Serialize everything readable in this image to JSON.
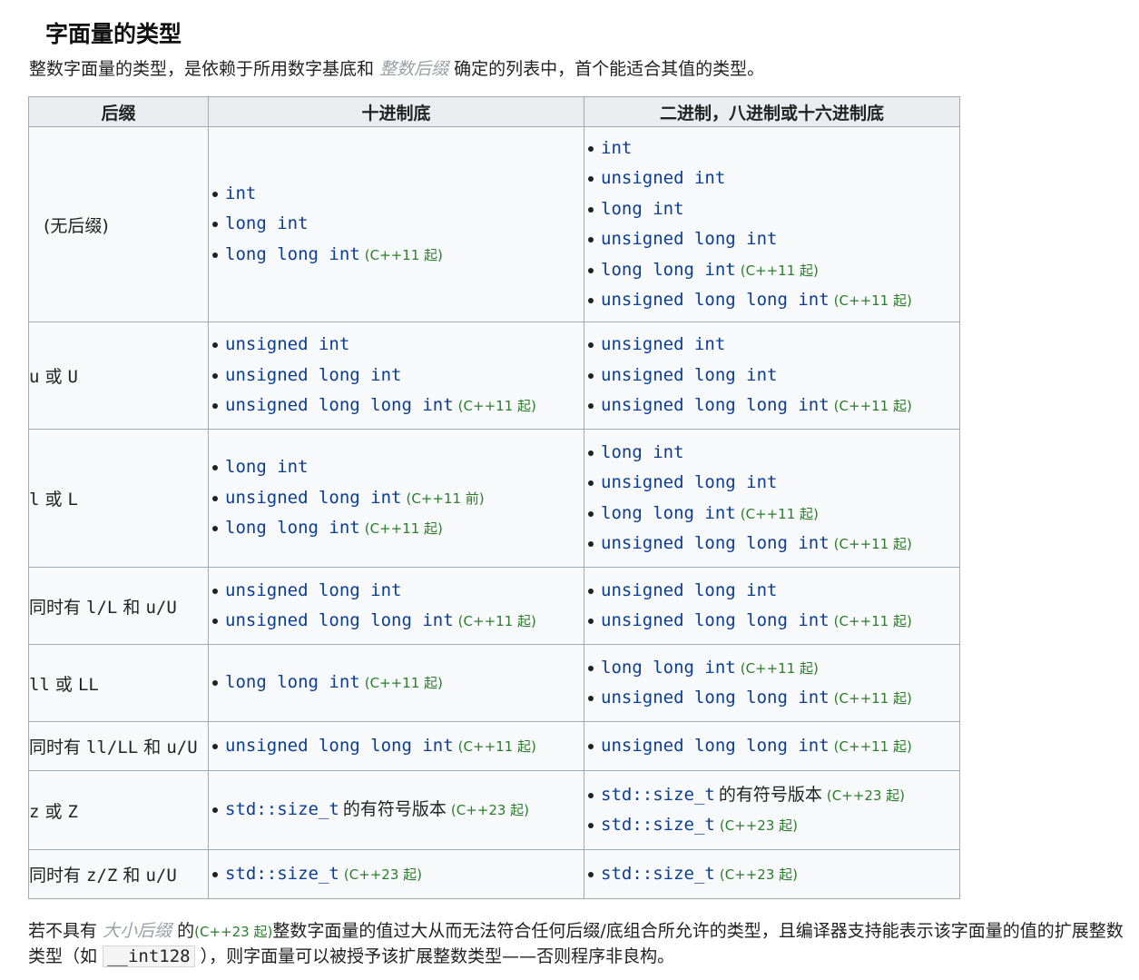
{
  "heading": "字面量的类型",
  "intro": {
    "before": "整数字面量的类型，是依赖于所用数字基底和",
    "link": "整数后缀",
    "after": "确定的列表中，首个能适合其值的类型。"
  },
  "table": {
    "headers": [
      "后缀",
      "十进制底",
      "二进制，八进制或十六进制底"
    ],
    "rows": [
      {
        "suffix": "(无后缀)",
        "decimal": [
          {
            "type": "int",
            "note": ""
          },
          {
            "type": "long int",
            "note": ""
          },
          {
            "type": "long long int",
            "note": "(C++11 起)"
          }
        ],
        "other": [
          {
            "type": "int",
            "note": ""
          },
          {
            "type": "unsigned int",
            "note": ""
          },
          {
            "type": "long int",
            "note": ""
          },
          {
            "type": "unsigned long int",
            "note": ""
          },
          {
            "type": "long long int",
            "note": "(C++11 起)"
          },
          {
            "type": "unsigned long long int",
            "note": "(C++11 起)"
          }
        ]
      },
      {
        "suffix_parts": [
          {
            "t": "u",
            "code": true
          },
          {
            "t": " 或 ",
            "code": false
          },
          {
            "t": "U",
            "code": true
          }
        ],
        "decimal": [
          {
            "type": "unsigned int",
            "note": ""
          },
          {
            "type": "unsigned long int",
            "note": ""
          },
          {
            "type": "unsigned long long int",
            "note": "(C++11 起)"
          }
        ],
        "other": [
          {
            "type": "unsigned int",
            "note": ""
          },
          {
            "type": "unsigned long int",
            "note": ""
          },
          {
            "type": "unsigned long long int",
            "note": "(C++11 起)"
          }
        ]
      },
      {
        "suffix_parts": [
          {
            "t": "l",
            "code": true
          },
          {
            "t": " 或 ",
            "code": false
          },
          {
            "t": "L",
            "code": true
          }
        ],
        "decimal": [
          {
            "type": "long int",
            "note": ""
          },
          {
            "type": "unsigned long int",
            "note": "(C++11 前)"
          },
          {
            "type": "long long int",
            "note": "(C++11 起)"
          }
        ],
        "other": [
          {
            "type": "long int",
            "note": ""
          },
          {
            "type": "unsigned long int",
            "note": ""
          },
          {
            "type": "long long int",
            "note": "(C++11 起)"
          },
          {
            "type": "unsigned long long int",
            "note": "(C++11 起)"
          }
        ]
      },
      {
        "suffix_parts": [
          {
            "t": "同时有 ",
            "code": false
          },
          {
            "t": "l/L",
            "code": true
          },
          {
            "t": " 和 ",
            "code": false
          },
          {
            "t": "u/U",
            "code": true
          }
        ],
        "decimal": [
          {
            "type": "unsigned long int",
            "note": ""
          },
          {
            "type": "unsigned long long int",
            "note": "(C++11 起)"
          }
        ],
        "other": [
          {
            "type": "unsigned long int",
            "note": ""
          },
          {
            "type": "unsigned long long int",
            "note": "(C++11 起)"
          }
        ]
      },
      {
        "suffix_parts": [
          {
            "t": "ll",
            "code": true
          },
          {
            "t": " 或 ",
            "code": false
          },
          {
            "t": "LL",
            "code": true
          }
        ],
        "decimal": [
          {
            "type": "long long int",
            "note": "(C++11 起)"
          }
        ],
        "other": [
          {
            "type": "long long int",
            "note": "(C++11 起)"
          },
          {
            "type": "unsigned long long int",
            "note": "(C++11 起)"
          }
        ]
      },
      {
        "suffix_parts": [
          {
            "t": "同时有 ",
            "code": false
          },
          {
            "t": "ll/LL",
            "code": true
          },
          {
            "t": " 和 ",
            "code": false
          },
          {
            "t": "u/U",
            "code": true
          }
        ],
        "decimal": [
          {
            "type": "unsigned long long int",
            "note": "(C++11 起)"
          }
        ],
        "other": [
          {
            "type": "unsigned long long int",
            "note": "(C++11 起)"
          }
        ]
      },
      {
        "suffix_parts": [
          {
            "t": "z",
            "code": true
          },
          {
            "t": " 或 ",
            "code": false
          },
          {
            "t": "Z",
            "code": true
          }
        ],
        "decimal": [
          {
            "type": "std::size_t",
            "extra": "的有符号版本",
            "note": "(C++23 起)"
          }
        ],
        "other": [
          {
            "type": "std::size_t",
            "extra": "的有符号版本",
            "note": "(C++23 起)"
          },
          {
            "type": "std::size_t",
            "note": "(C++23 起)"
          }
        ]
      },
      {
        "suffix_parts": [
          {
            "t": "同时有 ",
            "code": false
          },
          {
            "t": "z/Z",
            "code": true
          },
          {
            "t": " 和 ",
            "code": false
          },
          {
            "t": "u/U",
            "code": true
          }
        ],
        "decimal": [
          {
            "type": "std::size_t",
            "note": "(C++23 起)"
          }
        ],
        "other": [
          {
            "type": "std::size_t",
            "note": "(C++23 起)"
          }
        ]
      }
    ]
  },
  "footer": {
    "p1": "若不具有",
    "link": "大小后缀",
    "p2": "的",
    "ver": "(C++23 起)",
    "p3": "整数字面量的值过大从而无法符合任何后缀/底组合所允许的类型，且编译器支持能表示该字面量的值的扩展整数类型（如",
    "code": "__int128",
    "p4": "），则字面量可以被授予该扩展整数类型——否则程序非良构。"
  }
}
